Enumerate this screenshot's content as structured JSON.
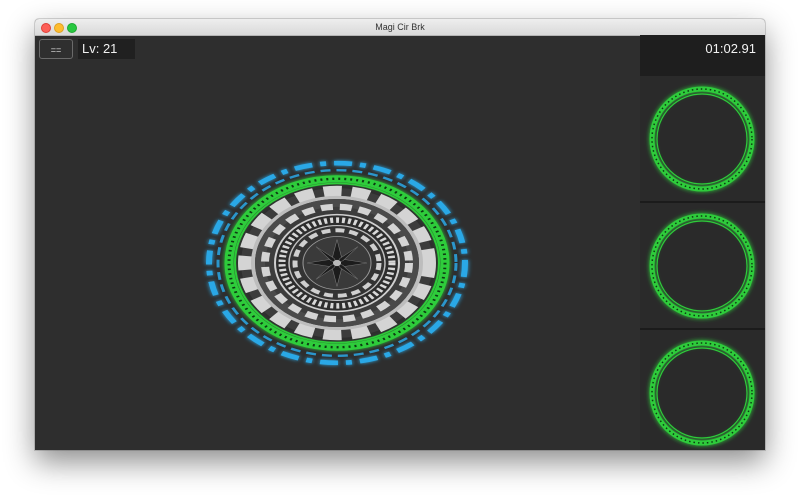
{
  "window": {
    "title": "Magi Cir Brk"
  },
  "toolbar": {
    "menu_label": "==",
    "level": "Lv: 21"
  },
  "timer": "01:02.91",
  "colors": {
    "ring_green": "#2ecc3a",
    "ring_blue": "#2aa8e6",
    "gear_light": "#d4d4d4",
    "gear_dark": "#3c3c3c",
    "background": "#2e2e2e"
  },
  "slots": [
    {
      "name": "slot-1",
      "icon": "magic-ring"
    },
    {
      "name": "slot-2",
      "icon": "magic-ring"
    },
    {
      "name": "slot-3",
      "icon": "magic-ring"
    }
  ]
}
